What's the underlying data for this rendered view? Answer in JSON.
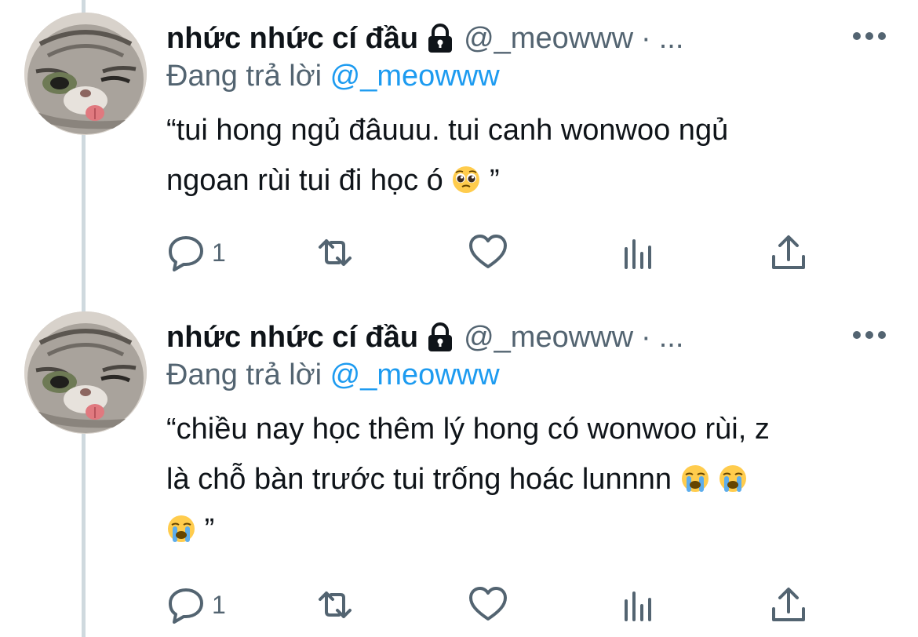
{
  "colors": {
    "text": "#0f1419",
    "secondary": "#536471",
    "link": "#1d9bf0",
    "thread_line": "#cfd9de"
  },
  "tweets": [
    {
      "display_name": "nhức nhức cí đầu",
      "locked_icon": "lock-icon",
      "handle": "@_meowww",
      "separator": "·",
      "ellipsis": "...",
      "replying_label": "Đang trả lời",
      "replying_to": "@_meowww",
      "text_lines": [
        "“tui hong ngủ đâuuu. tui canh wonwoo ngủ",
        "ngoan rùi tui đi học ó",
        "”"
      ],
      "emojis": [
        "pleading-face"
      ],
      "reply_count": "1"
    },
    {
      "display_name": "nhức nhức cí đầu",
      "locked_icon": "lock-icon",
      "handle": "@_meowww",
      "separator": "·",
      "ellipsis": "...",
      "replying_label": "Đang trả lời",
      "replying_to": "@_meowww",
      "text_lines": [
        "“chiều nay học thêm lý hong có wonwoo rùi, z",
        "là chỗ bàn trước tui trống hoác lunnnn",
        "”"
      ],
      "emojis": [
        "loudly-crying-face",
        "loudly-crying-face",
        "loudly-crying-face"
      ],
      "reply_count": "1"
    }
  ]
}
